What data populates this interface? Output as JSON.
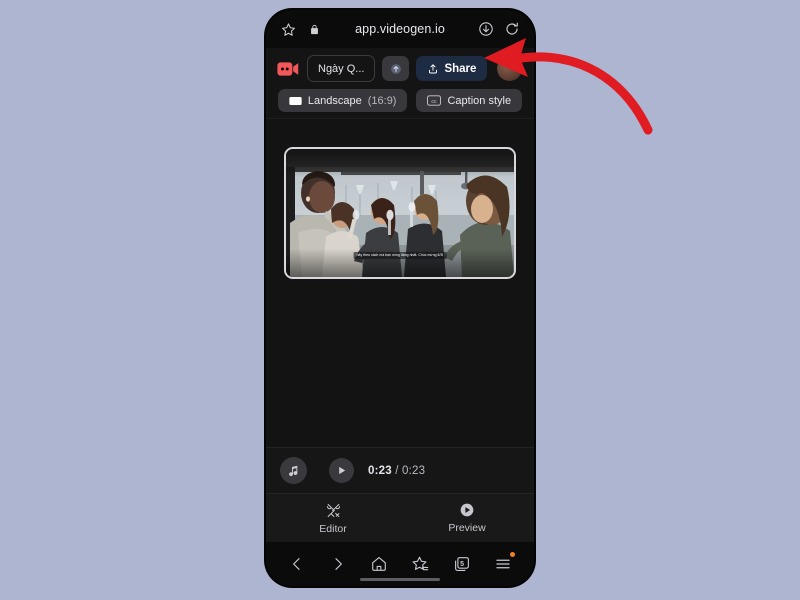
{
  "browser": {
    "url": "app.videogen.io",
    "icons": {
      "bookmark": "star-icon",
      "lock": "lock-icon",
      "download": "download-icon",
      "reload": "reload-icon"
    },
    "nav": {
      "back_label": "Back",
      "forward_label": "Forward",
      "home_label": "Home",
      "bookmarks_label": "Bookmarks",
      "tabs_label": "Tabs",
      "tab_count": "5",
      "menu_label": "Menu",
      "menu_has_badge": true
    }
  },
  "app": {
    "logo": "video-camera-icon",
    "logo_color": "#f2585b",
    "toolbar": {
      "project_title": "Ngày Q...",
      "upgrade_label": "Upgrade",
      "share_label": "Share",
      "share_bg": "#1d2b43",
      "aspect_ratio_label": "Landscape",
      "aspect_ratio_value": "(16:9)",
      "caption_style_label": "Caption style"
    },
    "preview": {
      "caption_text": "hãy theo cách mà bạn xứng đáng nhất. Chúc mừng 8/3!"
    },
    "player": {
      "music_label": "Music",
      "play_label": "Play",
      "current_time": "0:23",
      "separator": "/",
      "total_time": "0:23"
    },
    "mode_tabs": [
      {
        "label": "Editor",
        "icon": "tools-icon",
        "active": false
      },
      {
        "label": "Preview",
        "icon": "play-circle-icon",
        "active": true
      }
    ]
  },
  "annotation": {
    "type": "arrow",
    "color": "#e11b22",
    "points_to": "share-button"
  }
}
